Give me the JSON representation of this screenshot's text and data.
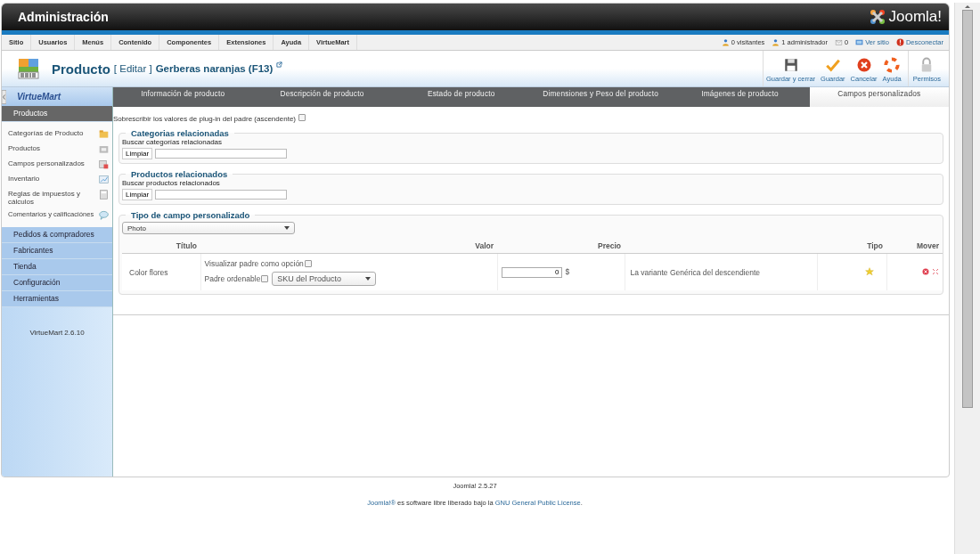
{
  "header": {
    "title": "Administración",
    "logo_text": "Joomla!"
  },
  "menu": {
    "items": [
      "Sitio",
      "Usuarios",
      "Menús",
      "Contenido",
      "Componentes",
      "Extensiones",
      "Ayuda",
      "VirtueMart"
    ],
    "status": [
      {
        "kind": "visitors",
        "text": "0 visitantes",
        "link": false
      },
      {
        "kind": "admins",
        "text": "1 administrador",
        "link": false
      },
      {
        "kind": "messages",
        "text": "0",
        "link": false
      },
      {
        "kind": "site",
        "text": "Ver sitio",
        "link": true
      },
      {
        "kind": "logout",
        "text": "Desconectar",
        "link": true
      }
    ]
  },
  "title_bar": {
    "title": "Producto",
    "action": "[ Editar ]",
    "product": "Gerberas naranjas (F13)"
  },
  "toolbar": [
    {
      "kind": "save",
      "label": "Guardar y cerrar"
    },
    {
      "kind": "apply",
      "label": "Guardar"
    },
    {
      "kind": "cancel",
      "label": "Cancelar"
    },
    {
      "kind": "help",
      "label": "Ayuda"
    },
    {
      "kind": "lock",
      "label": "Permisos"
    }
  ],
  "sidebar": {
    "logo_text": "VirtueMart",
    "sections": [
      {
        "label": "Productos",
        "expanded": true,
        "items": [
          {
            "label": "Categorías de Producto"
          },
          {
            "label": "Productos"
          },
          {
            "label": "Campos personalizados"
          },
          {
            "label": "Inventario"
          },
          {
            "label": "Reglas de impuestos y cálculos"
          },
          {
            "label": "Comentarios y calificaciónes"
          }
        ]
      },
      {
        "label": "Pedidos & compradores",
        "expanded": false
      },
      {
        "label": "Fabricantes",
        "expanded": false
      },
      {
        "label": "Tienda",
        "expanded": false
      },
      {
        "label": "Configuración",
        "expanded": false
      },
      {
        "label": "Herramientas",
        "expanded": false
      }
    ],
    "version": "VirtueMart 2.6.10"
  },
  "tabs": [
    {
      "label": "Información de producto",
      "selected": false
    },
    {
      "label": "Descripción de producto",
      "selected": false
    },
    {
      "label": "Estado de producto",
      "selected": false
    },
    {
      "label": "Dimensiones y Peso del producto",
      "selected": false
    },
    {
      "label": "Imágenes de producto",
      "selected": false
    },
    {
      "label": "Campos personalizados",
      "selected": true
    }
  ],
  "override": {
    "label": "Sobrescribir los valores de plug-in del padre (ascendente)",
    "checked": false
  },
  "related": [
    {
      "legend": "Categorias relacionadas",
      "hint": "Buscar categorías relacionadas",
      "button": "Limpiar"
    },
    {
      "legend": "Productos relacionados",
      "hint": "Buscar productos relacionados",
      "button": "Limpiar"
    }
  ],
  "custom_fields": {
    "legend": "Tipo de campo personalizado",
    "type_select": "Photo",
    "columns": [
      "Título",
      "Valor",
      "Precio",
      "",
      "Tipo",
      "Mover"
    ],
    "rows": [
      {
        "title": "Color flores",
        "show_parent": {
          "label": "Visualizar padre como opción",
          "checked": false
        },
        "orderable": {
          "label": "Padre ordenable",
          "checked": false
        },
        "order_select": "SKU del Producto",
        "price": "0",
        "currency": "$",
        "description": "La variante Genérica del descendiente"
      }
    ]
  },
  "footer": {
    "version": "Joomla! 2.5.27",
    "license": [
      {
        "text": "Joomla!®",
        "link": true
      },
      {
        "text": " es software libre liberado bajo la ",
        "link": false
      },
      {
        "text": "GNU General Public License",
        "link": true
      },
      {
        "text": "."
      }
    ]
  }
}
